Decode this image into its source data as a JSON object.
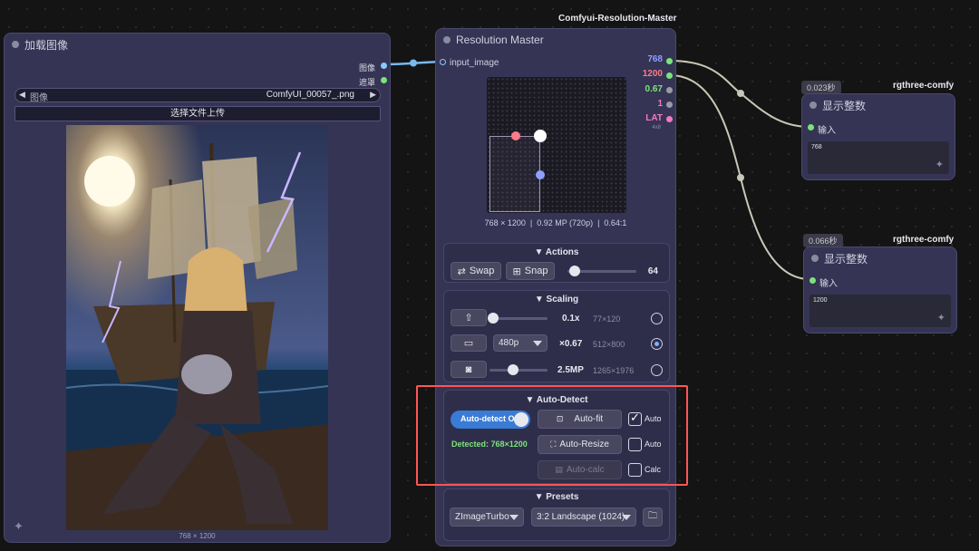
{
  "load_node": {
    "title": "加载图像",
    "outputs": [
      "图像",
      "遮罩"
    ],
    "image_widget": {
      "label": "图像",
      "value": "ComfyUI_00057_.png"
    },
    "upload_button": "选择文件上传",
    "image_size_caption": "768 × 1200"
  },
  "resolution_node": {
    "group_label": "Comfyui-Resolution-Master",
    "title": "Resolution Master",
    "input_label": "input_image",
    "outputs": [
      {
        "value": "768",
        "color": "#8fa0ff"
      },
      {
        "value": "1200",
        "color": "#ff7a8a"
      },
      {
        "value": "0.67",
        "color": "#7ce37c"
      },
      {
        "value": "1",
        "color": "#f07bc0"
      },
      {
        "value": "LAT",
        "color": "#f07bc0",
        "sub": "4x8"
      }
    ],
    "canvas_info": "768 × 1200  |  0.92 MP (720p)  |  0.64:1",
    "actions": {
      "title": "▼ Actions",
      "swap_label": "Swap",
      "snap_label": "Snap",
      "snap_value": "64",
      "snap_level": 0.15
    },
    "scaling": {
      "title": "▼ Scaling",
      "rows": [
        {
          "icon": "upscale-icon",
          "value": "0.1x",
          "result": "77×120",
          "selected": false,
          "level": 0.03
        },
        {
          "icon": "tv-icon",
          "select": "480p",
          "value": "×0.67",
          "result": "512×800",
          "selected": true
        },
        {
          "icon": "camera-icon",
          "value": "2.5MP",
          "result": "1265×1976",
          "selected": false,
          "level": 0.33
        }
      ]
    },
    "auto_detect": {
      "title": "▼ Auto-Detect",
      "toggle_label": "Auto-detect ON",
      "detected_text": "Detected: 768×1200",
      "autofit_label": "Auto-fit",
      "autoresize_label": "Auto-Resize",
      "autocalc_label": "Auto-calc",
      "checks": [
        {
          "label": "Auto",
          "checked": true
        },
        {
          "label": "Auto",
          "checked": false
        },
        {
          "label": "Calc",
          "checked": false
        }
      ],
      "highlight_color": "#ff5555"
    },
    "presets": {
      "title": "▼ Presets",
      "model": "ZImageTurbo",
      "preset": "3:2 Landscape (1024)"
    }
  },
  "display_nodes": [
    {
      "badge": "0.023秒",
      "source": "rgthree-comfy",
      "title": "显示整数",
      "input_label": "输入",
      "value": "768"
    },
    {
      "badge": "0.066秒",
      "source": "rgthree-comfy",
      "title": "显示整数",
      "input_label": "输入",
      "value": "1200"
    }
  ],
  "colors": {
    "node_bg": "#353454",
    "wire": "#c8c8b8",
    "wire_blue": "#7ab8f0",
    "accent_blue": "#3a7bd5",
    "detected_green": "#7ce37c"
  }
}
